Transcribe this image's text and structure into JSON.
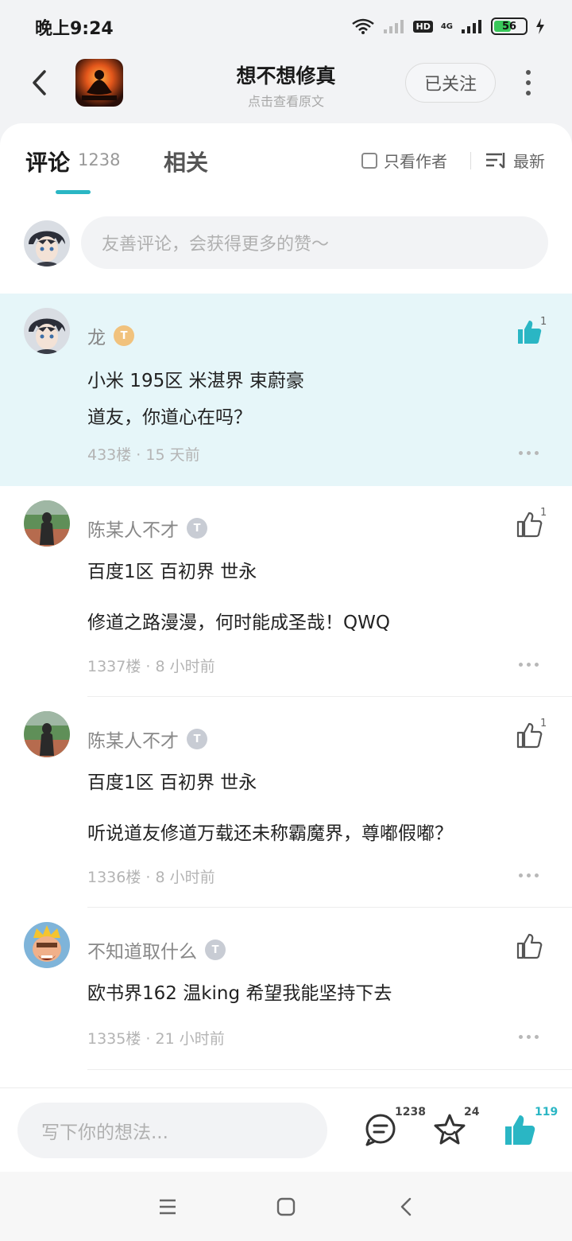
{
  "status_bar": {
    "time": "晚上9:24",
    "hd": "HD",
    "network": "4G",
    "battery": "56",
    "battery_level": 0.56
  },
  "header": {
    "title": "想不想修真",
    "subtitle": "点击查看原文",
    "follow_label": "已关注"
  },
  "tabs": {
    "comments_label": "评论",
    "comments_count": "1238",
    "related_label": "相关",
    "author_only_label": "只看作者",
    "sort_label": "最新"
  },
  "compose": {
    "placeholder": "友善评论，会获得更多的赞～"
  },
  "comments": [
    {
      "user": "龙",
      "level": "T",
      "lines": [
        "小米 195区 米湛界  束蔚豪",
        " 道友，你道心在吗？"
      ],
      "floor": "433楼",
      "time": "15 天前",
      "likes": "1"
    },
    {
      "user": "陈某人不才",
      "level": "T",
      "lines": [
        "百度1区 百初界 世永",
        "修道之路漫漫，何时能成圣哉！QWQ"
      ],
      "floor": "1337楼",
      "time": "8 小时前",
      "likes": "1"
    },
    {
      "user": "陈某人不才",
      "level": "T",
      "lines": [
        "百度1区 百初界 世永",
        "听说道友修道万载还未称霸魔界，尊嘟假嘟？"
      ],
      "floor": "1336楼",
      "time": "8 小时前",
      "likes": "1"
    },
    {
      "user": "不知道取什么",
      "level": "T",
      "lines": [
        "欧书界162 温king 希望我能坚持下去"
      ],
      "floor": "1335楼",
      "time": "21 小时前",
      "likes": ""
    }
  ],
  "meta_separator": " · ",
  "bottom_bar": {
    "placeholder": "写下你的想法...",
    "comment_count": "1238",
    "favorite_count": "24",
    "like_count": "119"
  },
  "icons": [
    "back-icon",
    "more-vertical-icon",
    "checkbox-icon",
    "sort-icon",
    "thumb-up-icon",
    "comment-icon",
    "star-icon",
    "menu-icon",
    "home-square-icon",
    "nav-back-icon"
  ],
  "colors": {
    "accent": "#2ab6c4",
    "highlight_bg": "#e6f6f9",
    "like_active": "#2ab6c4"
  }
}
